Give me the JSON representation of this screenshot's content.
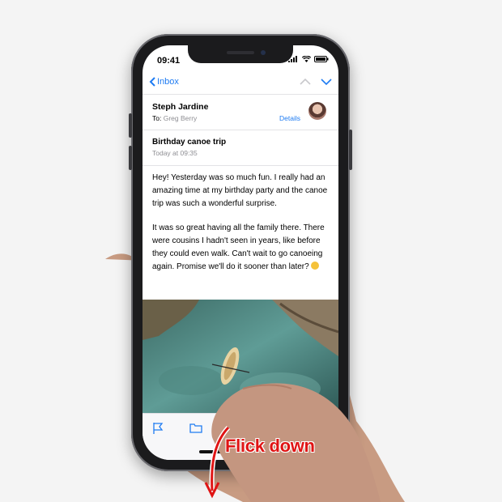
{
  "status_bar": {
    "time": "09:41"
  },
  "nav": {
    "back_label": "Inbox"
  },
  "header": {
    "sender": "Steph Jardine",
    "to_prefix": "To:",
    "to_name": "Greg Berry",
    "details_label": "Details"
  },
  "message": {
    "subject": "Birthday canoe trip",
    "date": "Today at 09:35",
    "paragraph_1": "Hey! Yesterday was so much fun. I really had an amazing time at my birthday party and the canoe trip was such a wonderful surprise.",
    "paragraph_2": "It was so great having all the family there. There were cousins I hadn't seen in years, like before they could even walk. Can't wait to go canoeing again. Promise we'll do it sooner than later?"
  },
  "annotation": {
    "label": "Flick down"
  },
  "colors": {
    "accent": "#1e7bf2",
    "annotation": "#e01414"
  },
  "icons": [
    "chevron-left-icon",
    "chevron-up-icon",
    "chevron-down-icon",
    "signal-icon",
    "wifi-icon",
    "battery-icon",
    "flag-icon",
    "folder-icon",
    "trash-icon",
    "reply-icon",
    "compose-icon",
    "smiley-emoji-icon",
    "down-arrow-icon"
  ]
}
